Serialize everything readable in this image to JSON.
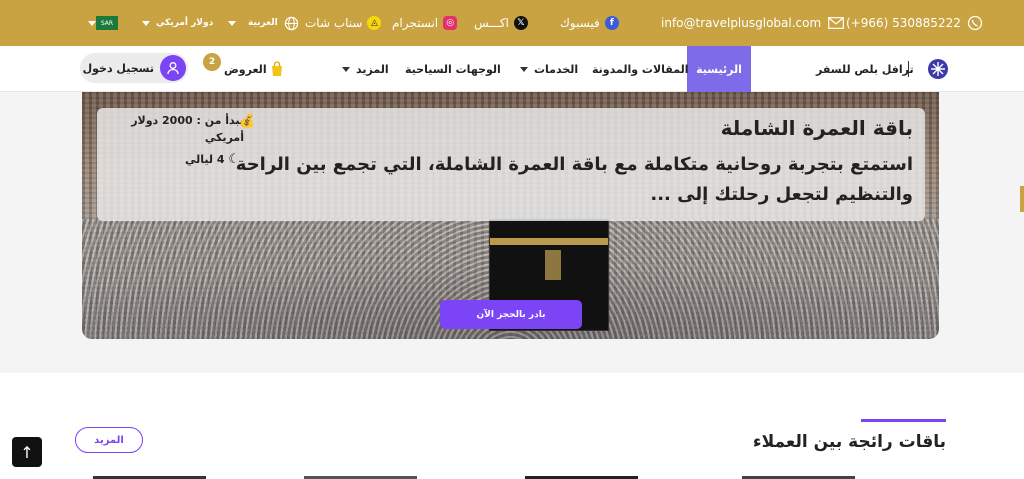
{
  "topbar": {
    "phone": "(+966) 530885222",
    "email": "info@travelplusglobal.com",
    "facebook": "فيسبوك",
    "x": "اكـــس",
    "instagram": "انستجرام",
    "snapchat": "سناب شات",
    "language": "العربية",
    "currency": "دولار أمريكي",
    "flag_text": "SAR"
  },
  "nav": {
    "brand": "ترافل بلص للسفر",
    "home": "الرئيسية",
    "blog": "المقالات والمدونة",
    "services": "الخدمات",
    "destinations": "الوجهات السياحية",
    "more": "المزيد",
    "offers": "العروض",
    "offers_count": "2",
    "login": "تسجيل دخول"
  },
  "hero": {
    "title": "باقة العمرة الشاملة",
    "description": "استمتع بتجربة روحانية متكاملة مع باقة العمرة الشاملة، التي تجمع بين الراحة والتنظيم لتجعل رحلتك إلى ...",
    "price": "يبدأ من : 2000 دولار أمريكي",
    "nights": "4 ليالي",
    "book_button": "بادر بالحجز الآن"
  },
  "section": {
    "title": "باقات رائجة بين العملاء",
    "more_button": "المزيد"
  },
  "colors": {
    "gold": "#c9a342",
    "purple": "#7b44f5",
    "nav_active": "#7d6bea"
  }
}
